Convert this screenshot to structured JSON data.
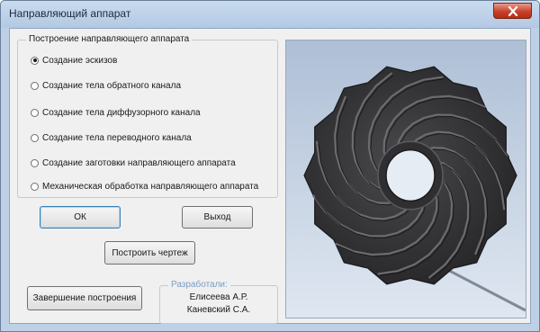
{
  "window": {
    "title": "Направляющий аппарат"
  },
  "construction_group": {
    "label": "Построение направляющего аппарата",
    "options": [
      {
        "label": "Создание эскизов",
        "selected": true
      },
      {
        "label": "Создание тела обратного канала",
        "selected": false
      },
      {
        "label": "Создание тела диффузорного канала",
        "selected": false
      },
      {
        "label": "Создание тела переводного канала",
        "selected": false
      },
      {
        "label": "Создание заготовки направляющего аппарата",
        "selected": false
      },
      {
        "label": "Механическая обработка направляющего аппарата",
        "selected": false
      }
    ]
  },
  "buttons": {
    "ok": "ОК",
    "exit": "Выход",
    "build_drawing": "Построить чертеж",
    "finish_build": "Завершение построения"
  },
  "credits": {
    "label": "Разработали:",
    "authors": [
      "Елисеева А.Р.",
      "Каневский С.А."
    ]
  },
  "colors": {
    "client_bg": "#f0f0f0",
    "titlebar": "#bdd0e6",
    "close_button": "#c8422c",
    "preview_bg": "#c6d3e4",
    "model": "#3a3a3c"
  },
  "preview": {
    "icon": "guide-vane-3d-model"
  }
}
